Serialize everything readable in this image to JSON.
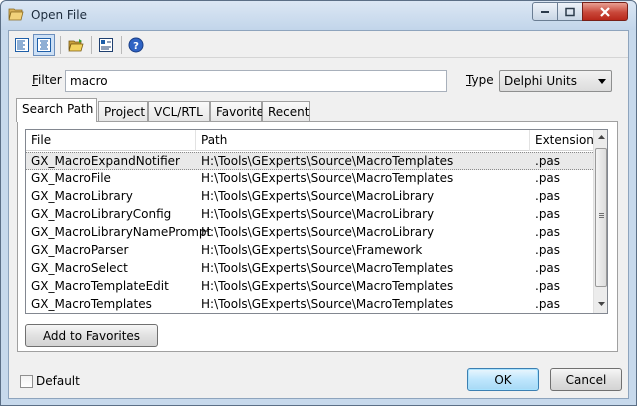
{
  "window": {
    "title": "Open File",
    "icon": "folder-open-icon"
  },
  "toolbar": {
    "buttons": [
      "left-align-icon",
      "center-align-icon",
      "open-folder-icon",
      "select-view-icon",
      "help-icon"
    ]
  },
  "filter": {
    "label": "Filter",
    "value": "macro"
  },
  "type": {
    "label": "Type",
    "selected": "Delphi Units"
  },
  "tabs": [
    {
      "label": "Search Path",
      "active": true
    },
    {
      "label": "Project",
      "active": false
    },
    {
      "label": "VCL/RTL",
      "active": false
    },
    {
      "label": "Favorite",
      "active": false
    },
    {
      "label": "Recent",
      "active": false
    }
  ],
  "grid": {
    "columns": [
      "File",
      "Path",
      "Extension"
    ],
    "rows": [
      {
        "file": "GX_MacroExpandNotifier",
        "path": "H:\\Tools\\GExperts\\Source\\MacroTemplates",
        "ext": ".pas"
      },
      {
        "file": "GX_MacroFile",
        "path": "H:\\Tools\\GExperts\\Source\\MacroTemplates",
        "ext": ".pas"
      },
      {
        "file": "GX_MacroLibrary",
        "path": "H:\\Tools\\GExperts\\Source\\MacroLibrary",
        "ext": ".pas"
      },
      {
        "file": "GX_MacroLibraryConfig",
        "path": "H:\\Tools\\GExperts\\Source\\MacroLibrary",
        "ext": ".pas"
      },
      {
        "file": "GX_MacroLibraryNamePrompt",
        "path": "H:\\Tools\\GExperts\\Source\\MacroLibrary",
        "ext": ".pas"
      },
      {
        "file": "GX_MacroParser",
        "path": "H:\\Tools\\GExperts\\Source\\Framework",
        "ext": ".pas"
      },
      {
        "file": "GX_MacroSelect",
        "path": "H:\\Tools\\GExperts\\Source\\MacroTemplates",
        "ext": ".pas"
      },
      {
        "file": "GX_MacroTemplateEdit",
        "path": "H:\\Tools\\GExperts\\Source\\MacroTemplates",
        "ext": ".pas"
      },
      {
        "file": "GX_MacroTemplates",
        "path": "H:\\Tools\\GExperts\\Source\\MacroTemplates",
        "ext": ".pas"
      }
    ]
  },
  "buttons": {
    "add_favorites": "Add to Favorites",
    "ok": "OK",
    "cancel": "Cancel"
  },
  "default_checkbox": {
    "label": "Default",
    "checked": false
  },
  "colors": {
    "title_bar": "#c2d5ea",
    "close_button": "#c9483a",
    "selected_row": "#e9e9e9",
    "default_button": "#bee6fd"
  }
}
